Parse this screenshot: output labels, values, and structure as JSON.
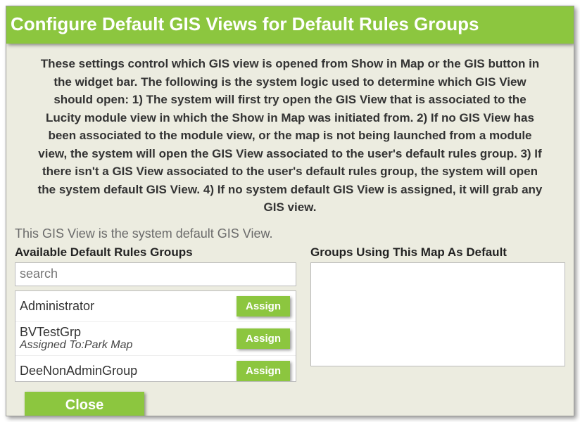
{
  "title": "Configure Default GIS Views for Default Rules Groups",
  "description": "These settings control which GIS view is opened from Show in Map or the GIS button in the widget bar. The following is the system logic used to determine which GIS View should open: 1) The system will first try open the GIS View that is associated to the Lucity module view in which the Show in Map was initiated from. 2) If no GIS View has been associated to the module view, or the map is not being launched from a module view, the system will open the GIS View associated to the user's default rules group. 3) If there isn't a GIS View associated to the user's default rules group, the system will open the system default GIS View. 4) If no system default GIS View is assigned, it will grab any GIS view.",
  "system_default_note": "This GIS View is the system default GIS View.",
  "left": {
    "heading": "Available Default Rules Groups",
    "search_placeholder": "search",
    "assign_label": "Assign",
    "items": [
      {
        "name": "Administrator",
        "assigned_to": ""
      },
      {
        "name": "BVTestGrp",
        "assigned_to": "Assigned To:Park Map"
      },
      {
        "name": "DeeNonAdminGroup",
        "assigned_to": ""
      }
    ]
  },
  "right": {
    "heading": "Groups Using This Map As Default",
    "items": []
  },
  "close_label": "Close"
}
